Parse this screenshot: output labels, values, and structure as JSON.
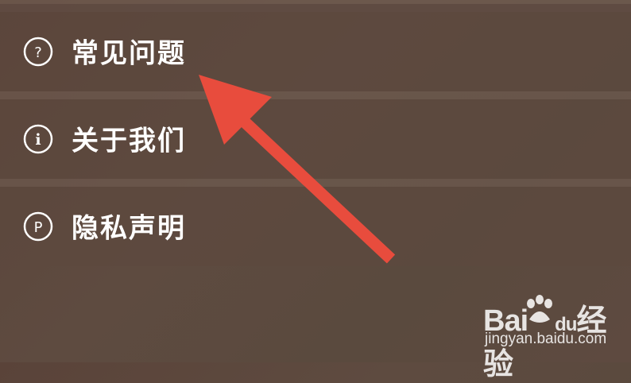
{
  "menu": {
    "items": [
      {
        "label": "常见问题",
        "icon": "question-icon",
        "glyph": "?"
      },
      {
        "label": "关于我们",
        "icon": "info-icon",
        "glyph": "i"
      },
      {
        "label": "隐私声明",
        "icon": "privacy-p-icon",
        "glyph": "P"
      }
    ]
  },
  "annotation": {
    "arrow_color": "#e84c3d",
    "target": "常见问题"
  },
  "watermark": {
    "brand_left": "Bai",
    "brand_right": "du",
    "product": "经验",
    "url": "jingyan.baidu.com"
  }
}
